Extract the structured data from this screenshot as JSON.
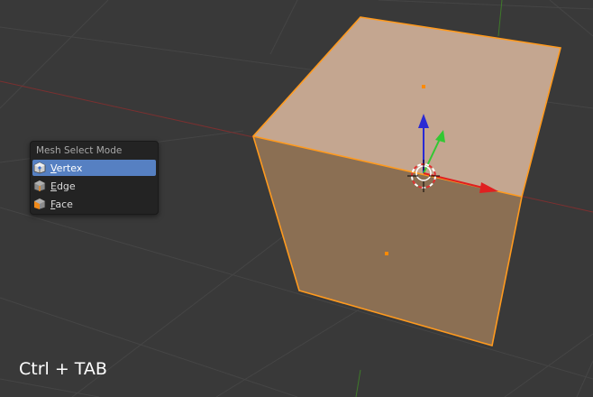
{
  "menu": {
    "title": "Mesh Select Mode",
    "items": [
      {
        "key": "V",
        "rest": "ertex",
        "icon": "vertex-select-icon",
        "active": true
      },
      {
        "key": "E",
        "rest": "dge",
        "icon": "edge-select-icon",
        "active": false
      },
      {
        "key": "F",
        "rest": "ace",
        "icon": "face-select-icon",
        "active": false
      }
    ]
  },
  "shortcut_hint": "Ctrl + TAB",
  "colors": {
    "viewport_bg": "#393939",
    "grid_line": "#474747",
    "x_axis": "#8a3535",
    "y_axis": "#4a8a2e",
    "cube_top": "#c4a690",
    "cube_front": "#8b6f53",
    "selection_outline": "#ff9a1e",
    "gizmo_x": "#e02020",
    "gizmo_y": "#32c832",
    "gizmo_z": "#2a2ad4",
    "menu_highlight": "#5680c2"
  }
}
